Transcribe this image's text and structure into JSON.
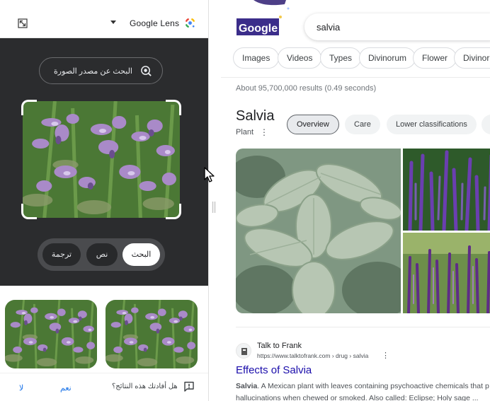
{
  "lens": {
    "title": "Google Lens",
    "source_button": "البحث عن مصدر الصورة",
    "modes": {
      "search": "البحث",
      "text": "نص",
      "translate": "ترجمة"
    },
    "feedback": {
      "question": "هل أفادتك هذه النتائج؟",
      "yes": "نعم",
      "no": "لا"
    }
  },
  "serp": {
    "logo_text": "Google",
    "query": "salvia",
    "filters": [
      "Images",
      "Videos",
      "Types",
      "Divinorum",
      "Flower",
      "Divinorum"
    ],
    "stats": "About 95,700,000 results (0.49 seconds)",
    "knowledge_panel": {
      "title": "Salvia",
      "subtitle": "Plant",
      "tabs": [
        "Overview",
        "Care",
        "Lower classifications"
      ]
    },
    "result": {
      "site_name": "Talk to Frank",
      "site_url": "https://www.talktofrank.com › drug › salvia",
      "title": "Effects of Salvia",
      "snippet_bold": "Salvia",
      "snippet_line1": ". A Mexican plant with leaves containing psychoactive chemicals that p",
      "snippet_line2": "hallucinations when chewed or smoked. Also called: Eclipse; Holy sage ..."
    }
  },
  "colors": {
    "lens_dark": "#2b2c2e",
    "link_blue": "#1a0dab",
    "accent_blue": "#1a73e8"
  },
  "icons": [
    "expand-icon",
    "chevron-down-icon",
    "google-lens-icon",
    "image-source-search-icon",
    "feedback-icon",
    "drag-handle-icon",
    "mouse-cursor-icon",
    "more-vert-icon",
    "site-favicon"
  ]
}
